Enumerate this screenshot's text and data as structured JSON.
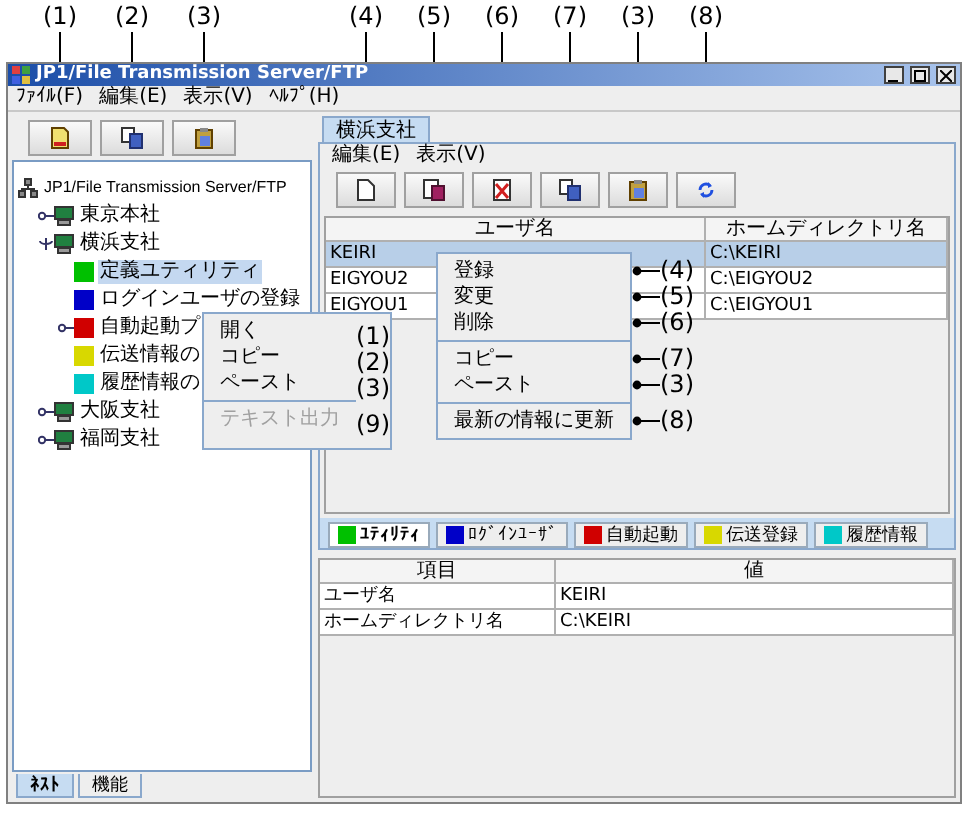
{
  "window": {
    "title": "JP1/File Transmission Server/FTP"
  },
  "menu_bar": [
    "ﾌｧｲﾙ(F)",
    "編集(E)",
    "表示(V)",
    "ﾍﾙﾌﾟ(H)"
  ],
  "left_pane": {
    "toolbar": [
      {
        "kind": "open",
        "callout": "(1)"
      },
      {
        "kind": "copy",
        "callout": "(2)"
      },
      {
        "kind": "paste",
        "callout": "(3)"
      }
    ],
    "tree": [
      {
        "label": "JP1/File Transmission Server/FTP",
        "kind": "network",
        "selected": false,
        "children": [
          {
            "label": "東京本社",
            "kind": "server",
            "selected": false,
            "expanded": false
          },
          {
            "label": "横浜支社",
            "kind": "server",
            "selected": false,
            "expanded": true,
            "children": [
              {
                "label": "定義ユティリティ",
                "kind": "function",
                "color": "#00c000",
                "selected": true
              },
              {
                "label": "ログインユーザの登録",
                "kind": "function",
                "color": "#0000c8",
                "selected": false
              },
              {
                "label": "自動起動プ",
                "kind": "function",
                "color": "#d00000",
                "selected": false,
                "expanded": false
              },
              {
                "label": "伝送情報の",
                "kind": "function",
                "color": "#d8d800",
                "selected": false
              },
              {
                "label": "履歴情報の",
                "kind": "function",
                "color": "#00c8c8",
                "selected": false
              }
            ]
          },
          {
            "label": "大阪支社",
            "kind": "server",
            "selected": false,
            "expanded": false
          },
          {
            "label": "福岡支社",
            "kind": "server",
            "selected": false,
            "expanded": false
          }
        ]
      }
    ],
    "context_menu": {
      "groups": [
        {
          "items": [
            {
              "label": "開く",
              "callout": "(1)",
              "disabled": false
            },
            {
              "label": "コピー",
              "callout": "(2)",
              "disabled": false
            },
            {
              "label": "ペースト",
              "callout": "(3)",
              "disabled": false
            }
          ]
        },
        {
          "items": [
            {
              "label": "テキスト出力",
              "callout": "(9)",
              "disabled": true
            }
          ]
        }
      ]
    },
    "bottom_tabs": [
      {
        "label": "ﾈｽﾄ",
        "selected": true
      },
      {
        "label": "機能",
        "selected": false
      }
    ]
  },
  "right_pane": {
    "tabs": [
      {
        "label": "横浜支社",
        "selected": true
      }
    ],
    "menu_bar": [
      "編集(E)",
      "表示(V)"
    ],
    "toolbar": [
      {
        "kind": "new",
        "callout": "(4)"
      },
      {
        "kind": "edit",
        "callout": "(5)"
      },
      {
        "kind": "delete",
        "callout": "(6)"
      },
      {
        "kind": "copy",
        "callout": "(7)"
      },
      {
        "kind": "paste",
        "callout": "(3)"
      },
      {
        "kind": "refresh",
        "callout": "(8)"
      }
    ],
    "table": {
      "columns": [
        "ユーザ名",
        "ホームディレクトリ名"
      ],
      "rows": [
        {
          "cells": [
            "KEIRI",
            "C:\\KEIRI"
          ],
          "selected": true
        },
        {
          "cells": [
            "EIGYOU2",
            "C:\\EIGYOU2"
          ],
          "selected": false
        },
        {
          "cells": [
            "EIGYOU1",
            "C:\\EIGYOU1"
          ],
          "selected": false
        }
      ]
    },
    "context_menu": {
      "groups": [
        {
          "items": [
            {
              "label": "登録",
              "callout": "(4)"
            },
            {
              "label": "変更",
              "callout": "(5)"
            },
            {
              "label": "削除",
              "callout": "(6)"
            }
          ]
        },
        {
          "items": [
            {
              "label": "コピー",
              "callout": "(7)"
            },
            {
              "label": "ペースト",
              "callout": "(3)"
            }
          ]
        },
        {
          "items": [
            {
              "label": "最新の情報に更新",
              "callout": "(8)"
            }
          ]
        }
      ]
    },
    "view_tabs": [
      {
        "label": "ﾕﾃｨﾘﾃｨ",
        "color": "#00c000",
        "selected": true
      },
      {
        "label": "ﾛｸﾞｲﾝﾕｰｻﾞ",
        "color": "#0000c8",
        "selected": false
      },
      {
        "label": "自動起動",
        "color": "#d00000",
        "selected": false
      },
      {
        "label": "伝送登録",
        "color": "#d8d800",
        "selected": false
      },
      {
        "label": "履歴情報",
        "color": "#00c8c8",
        "selected": false
      }
    ],
    "detail_table": {
      "columns": [
        "項目",
        "値"
      ],
      "rows": [
        {
          "cells": [
            "ユーザ名",
            "KEIRI"
          ]
        },
        {
          "cells": [
            "ホームディレクトリ名",
            "C:\\KEIRI"
          ]
        }
      ]
    }
  }
}
